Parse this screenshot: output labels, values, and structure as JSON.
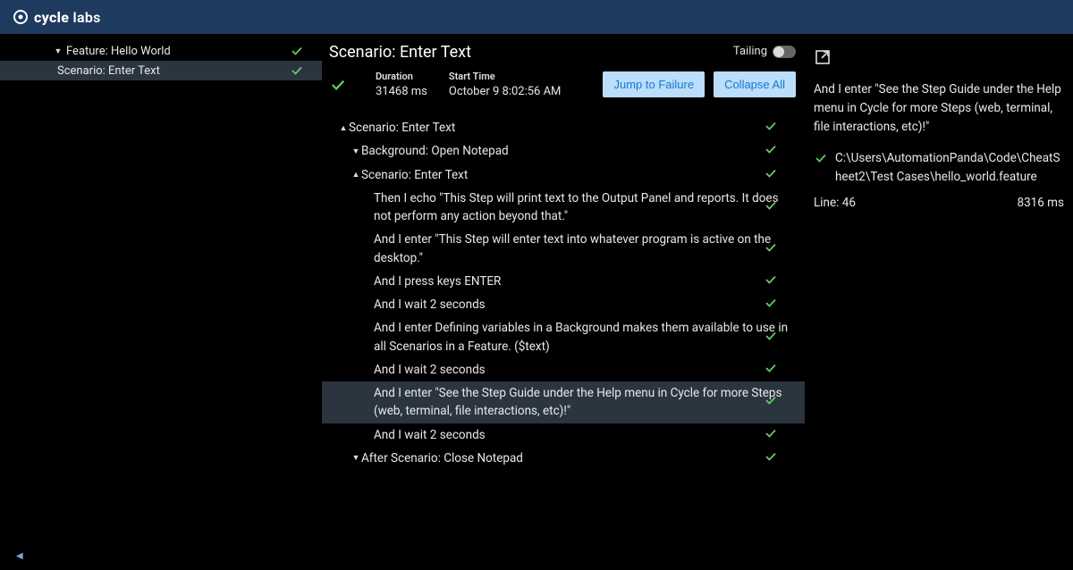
{
  "brand": {
    "bold": "cycle",
    "light": "labs"
  },
  "tree": {
    "feature_label": "Feature: Hello World",
    "scenario_label": "Scenario: Enter Text"
  },
  "center": {
    "title": "Scenario: Enter Text",
    "duration_label": "Duration",
    "duration_value": "31468 ms",
    "start_label": "Start Time",
    "start_value": "October 9 8:02:56 AM",
    "tailing_label": "Tailing",
    "jump_btn": "Jump to Failure",
    "collapse_btn": "Collapse All"
  },
  "steps": [
    {
      "level": 0,
      "caret": "up",
      "text": "Scenario: Enter Text",
      "highlight": false
    },
    {
      "level": 1,
      "caret": "down",
      "text": "Background: Open Notepad",
      "highlight": false
    },
    {
      "level": 1,
      "caret": "up",
      "text": "Scenario: Enter Text",
      "highlight": false
    },
    {
      "level": 2,
      "caret": "",
      "text": "Then I echo \"This Step will print text to the Output Panel and reports. It does not perform any action beyond that.\"",
      "highlight": false
    },
    {
      "level": 2,
      "caret": "",
      "text": "And I enter \"This Step will enter text into whatever program is active on the desktop.\"",
      "highlight": false
    },
    {
      "level": 2,
      "caret": "",
      "text": "And I press keys ENTER",
      "highlight": false
    },
    {
      "level": 2,
      "caret": "",
      "text": "And I wait 2 seconds",
      "highlight": false
    },
    {
      "level": 2,
      "caret": "",
      "text": "And I enter Defining variables in a Background makes them available to use in all Scenarios in a Feature. ($text)",
      "highlight": false
    },
    {
      "level": 2,
      "caret": "",
      "text": "And I wait 2 seconds",
      "highlight": false
    },
    {
      "level": 2,
      "caret": "",
      "text": "And I enter \"See the Step Guide under the Help menu in Cycle for more Steps (web, terminal, file interactions, etc)!\"",
      "highlight": true
    },
    {
      "level": 2,
      "caret": "",
      "text": "And I wait 2 seconds",
      "highlight": false
    },
    {
      "level": 1,
      "caret": "down",
      "text": "After Scenario: Close Notepad",
      "highlight": false
    }
  ],
  "detail": {
    "step_text": "And I enter \"See the Step Guide under the Help menu in Cycle for more Steps (web, terminal, file interactions, etc)!\"",
    "path": "C:\\Users\\AutomationPanda\\Code\\CheatSheet2\\Test Cases\\hello_world.feature",
    "line_label": "Line: 46",
    "duration": "8316 ms"
  }
}
